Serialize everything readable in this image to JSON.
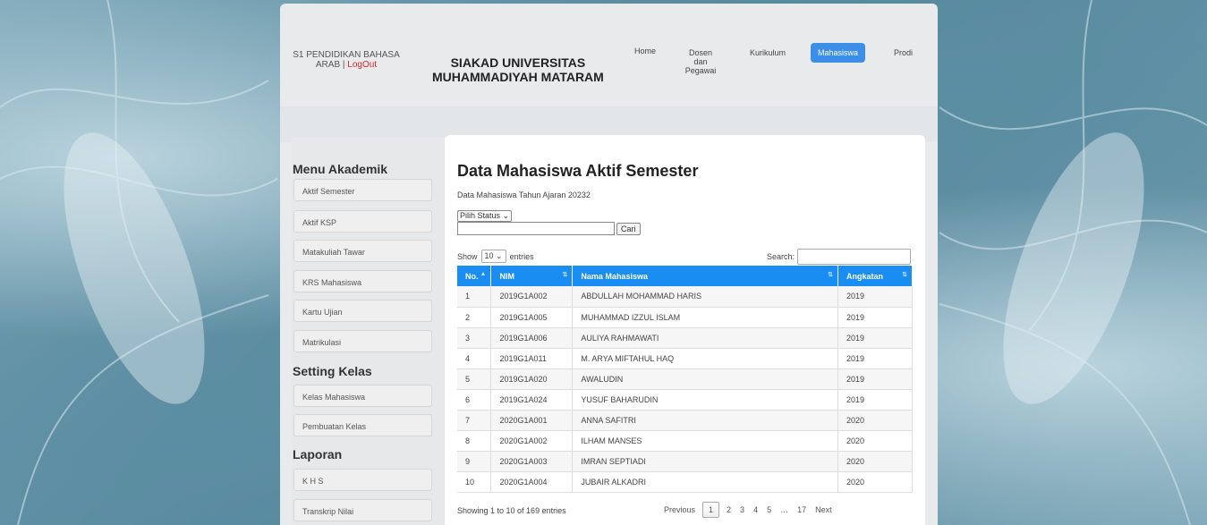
{
  "header": {
    "prodi": "S1 PENDIDIKAN BAHASA ARAB",
    "separator": "|",
    "logout": "LogOut",
    "brand_line1": "SIAKAD UNIVERSITAS",
    "brand_line2": "MUHAMMADIYAH MATARAM",
    "nav": {
      "home": "Home",
      "dosen_line1": "Dosen",
      "dosen_line2": "dan",
      "dosen_line3": "Pegawai",
      "kurikulum": "Kurikulum",
      "mahasiswa": "Mahasiswa",
      "prodi": "Prodi"
    },
    "active_color": "#3b8fe8"
  },
  "sidebar": {
    "menu_akademik": "Menu Akademik",
    "akademik_items": [
      "Aktif Semester",
      "Aktif KSP",
      "Matakuliah Tawar",
      "KRS Mahasiswa",
      "Kartu Ujian",
      "Matrikulasi"
    ],
    "setting_kelas": "Setting Kelas",
    "kelas_items": [
      "Kelas Mahasiswa",
      "Pembuatan Kelas"
    ],
    "laporan": "Laporan",
    "laporan_items": [
      "K H S",
      "Transkrip Nilai"
    ]
  },
  "main": {
    "title": "Data Mahasiswa Aktif Semester",
    "subtitle": "Data Mahasiswa Tahun Ajaran 20232",
    "status_select": "Pilih Status",
    "cari": "Cari",
    "show": "Show",
    "entries_value": "10",
    "entries": "entries",
    "search_label": "Search:",
    "columns": [
      "No.",
      "NIM",
      "Nama Mahasiswa",
      "Angkatan"
    ],
    "rows": [
      [
        "1",
        "2019G1A002",
        "ABDULLAH MOHAMMAD HARIS",
        "2019"
      ],
      [
        "2",
        "2019G1A005",
        "MUHAMMAD IZZUL ISLAM",
        "2019"
      ],
      [
        "3",
        "2019G1A006",
        "AULIYA RAHMAWATI",
        "2019"
      ],
      [
        "4",
        "2019G1A011",
        "M. ARYA MIFTAHUL HAQ",
        "2019"
      ],
      [
        "5",
        "2019G1A020",
        "AWALUDIN",
        "2019"
      ],
      [
        "6",
        "2019G1A024",
        "YUSUF BAHARUDIN",
        "2019"
      ],
      [
        "7",
        "2020G1A001",
        "ANNA SAFITRI",
        "2020"
      ],
      [
        "8",
        "2020G1A002",
        "ILHAM MANSES",
        "2020"
      ],
      [
        "9",
        "2020G1A003",
        "IMRAN SEPTIADI",
        "2020"
      ],
      [
        "10",
        "2020G1A004",
        "JUBAIR ALKADRI",
        "2020"
      ]
    ],
    "info": "Showing 1 to 10 of 169 entries",
    "pager": {
      "previous": "Previous",
      "pages": [
        "1",
        "2",
        "3",
        "4",
        "5"
      ],
      "ellipsis": "…",
      "last": "17",
      "next": "Next"
    },
    "header_color": "#1a8df2"
  }
}
